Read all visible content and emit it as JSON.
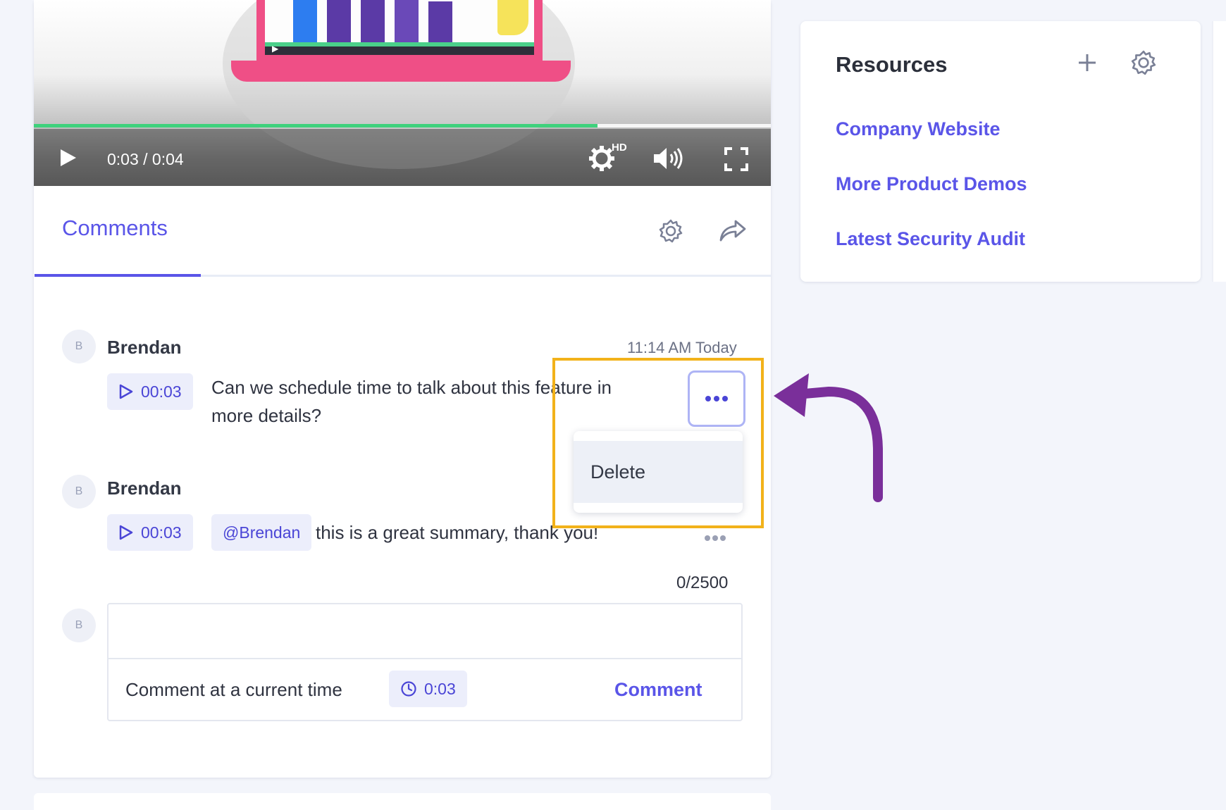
{
  "video": {
    "timecode": "0:03 / 0:04",
    "progress_fraction": 0.765,
    "quality_badge": "HD",
    "icons": [
      "play-icon",
      "settings-gear-icon",
      "volume-icon",
      "fullscreen-icon"
    ]
  },
  "comments": {
    "tab_label": "Comments",
    "items": [
      {
        "avatar_initial": "B",
        "author": "Brendan",
        "timestamp": "11:14 AM Today",
        "time_chip": "00:03",
        "text_line1": "Can we schedule time to talk about this feature in",
        "text_line2": "more details?"
      },
      {
        "avatar_initial": "B",
        "author": "Brendan",
        "time_chip": "00:03",
        "mention": "@Brendan",
        "text": "this is a great summary, thank you!"
      }
    ],
    "menu": {
      "delete_label": "Delete"
    },
    "composer": {
      "avatar_initial": "B",
      "char_count": "0/2500",
      "input_value": "",
      "time_label": "Comment at a current time",
      "time_value": "0:03",
      "submit_label": "Comment"
    }
  },
  "resources": {
    "title": "Resources",
    "links": [
      "Company Website",
      "More Product Demos",
      "Latest Security Audit"
    ]
  },
  "colors": {
    "accent": "#5a55e8",
    "progress": "#3fd17c",
    "highlight": "#f2b21a",
    "annotation_arrow": "#7a2f9a"
  }
}
